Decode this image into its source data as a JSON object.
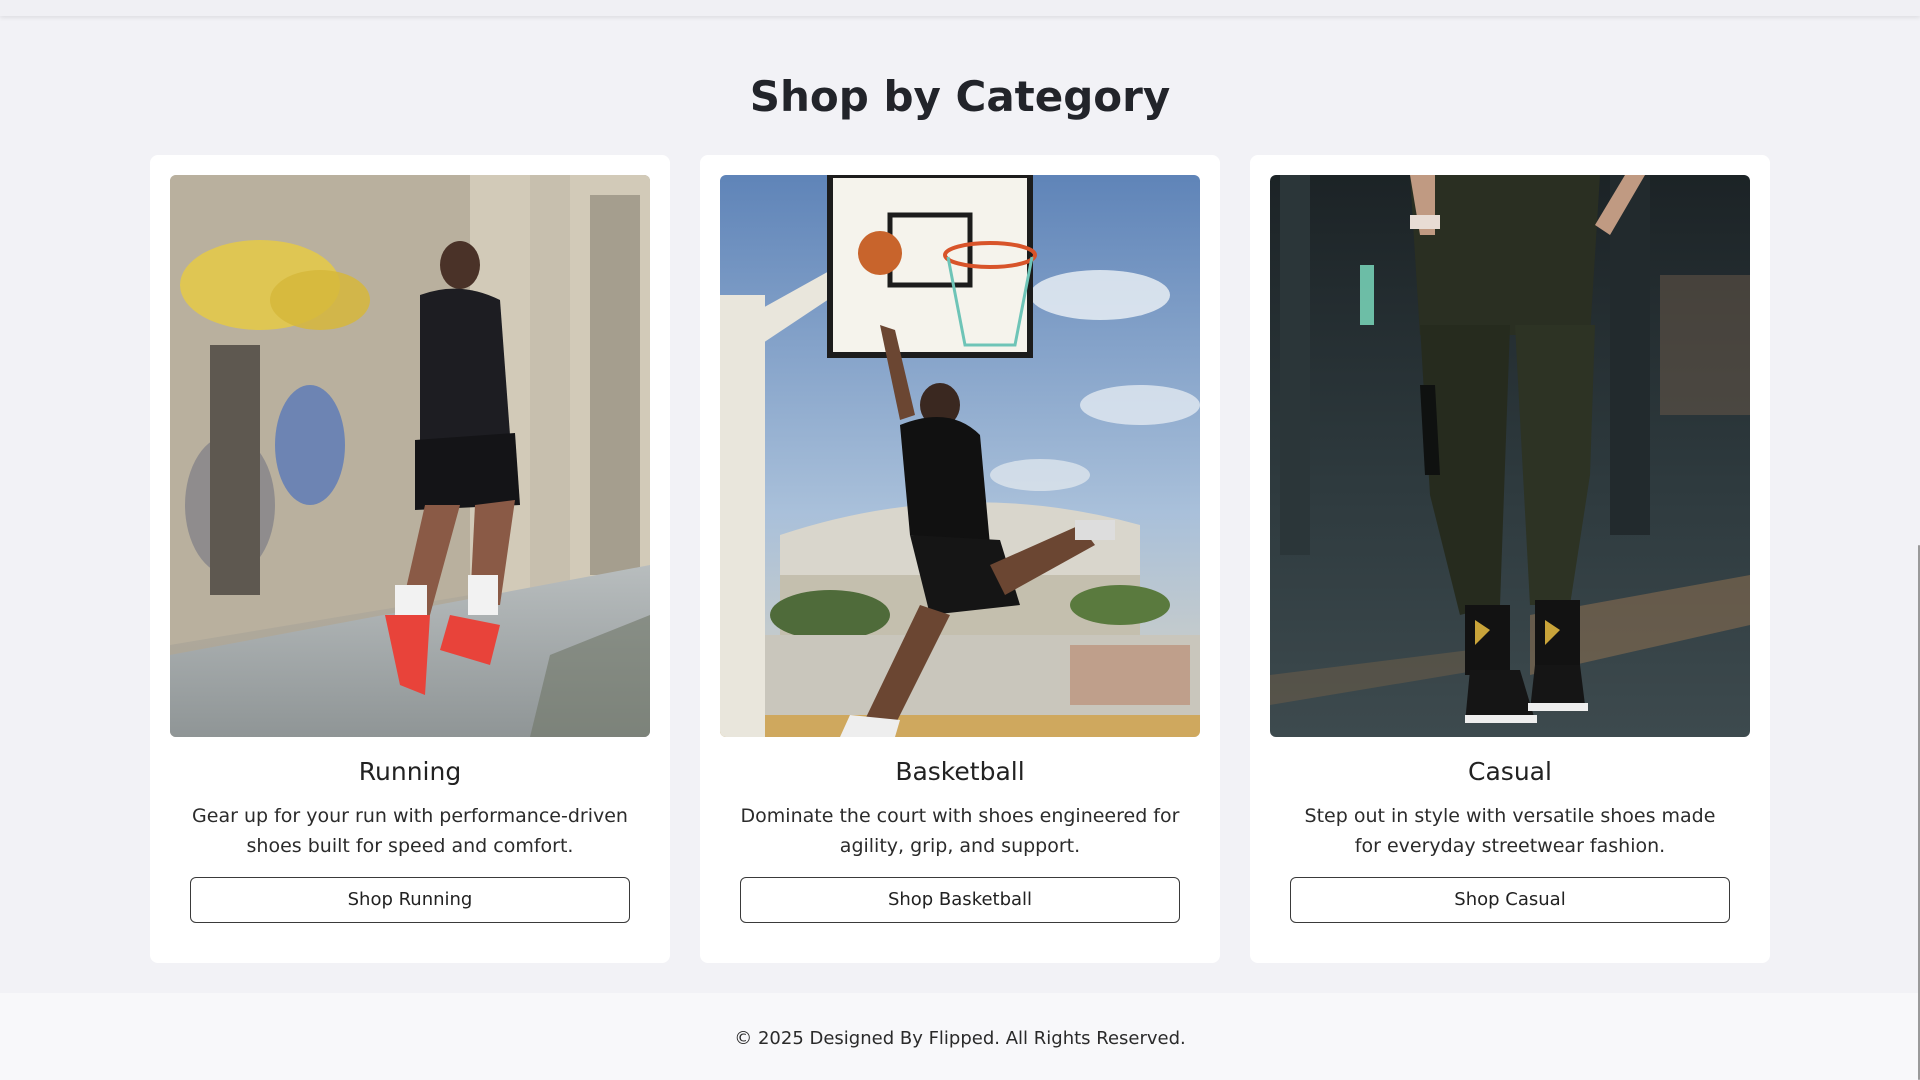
{
  "section": {
    "title": "Shop by Category"
  },
  "categories": [
    {
      "title": "Running",
      "description": "Gear up for your run with performance-driven shoes built for speed and comfort.",
      "button_label": "Shop Running"
    },
    {
      "title": "Basketball",
      "description": "Dominate the court with shoes engineered for agility, grip, and support.",
      "button_label": "Shop Basketball"
    },
    {
      "title": "Casual",
      "description": "Step out in style with versatile shoes made for everyday streetwear fashion.",
      "button_label": "Shop Casual"
    }
  ],
  "footer": {
    "text": "© 2025 Designed By Flipped. All Rights Reserved."
  },
  "colors": {
    "page_background": "#f2f2f6",
    "card_background": "#ffffff",
    "text": "#222222"
  }
}
